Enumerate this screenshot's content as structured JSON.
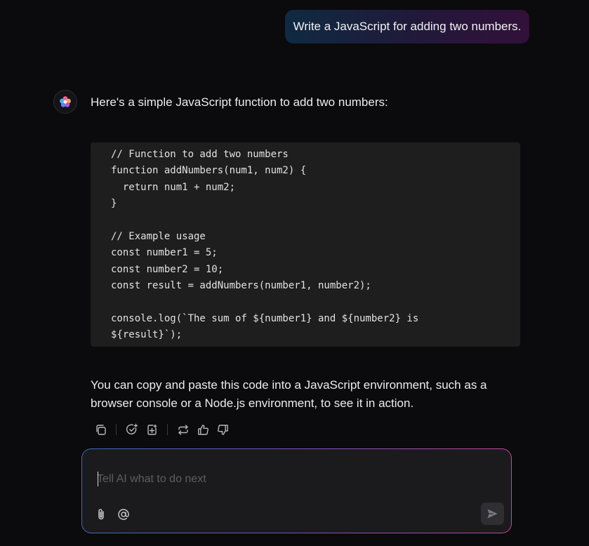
{
  "conversation": {
    "user_message": "Write a JavaScript for adding two numbers.",
    "assistant": {
      "intro": "Here's a simple JavaScript function to add two numbers:",
      "code_lines": [
        "// Function to add two numbers",
        "function addNumbers(num1, num2) {",
        "  return num1 + num2;",
        "}",
        "",
        "// Example usage",
        "const number1 = 5;",
        "const number2 = 10;",
        "const result = addNumbers(number1, number2);",
        "",
        "console.log(`The sum of ${number1} and ${number2} is",
        "${result}`);"
      ],
      "summary": "You can copy and paste this code into a JavaScript environment, such as a browser console or a Node.js environment, to see it in action."
    }
  },
  "actions": [
    {
      "icon": "copy-icon"
    },
    {
      "icon": "check-add-icon"
    },
    {
      "icon": "add-page-icon"
    },
    {
      "icon": "regenerate-icon"
    },
    {
      "icon": "thumbs-up-icon"
    },
    {
      "icon": "thumbs-down-icon"
    }
  ],
  "composer": {
    "placeholder": "Tell AI what to do next",
    "value": ""
  },
  "colors": {
    "background": "#0b0a0c",
    "code_background": "#1e1e1f",
    "gradient_start": "#3a6fb8",
    "gradient_end": "#c04a9c"
  }
}
